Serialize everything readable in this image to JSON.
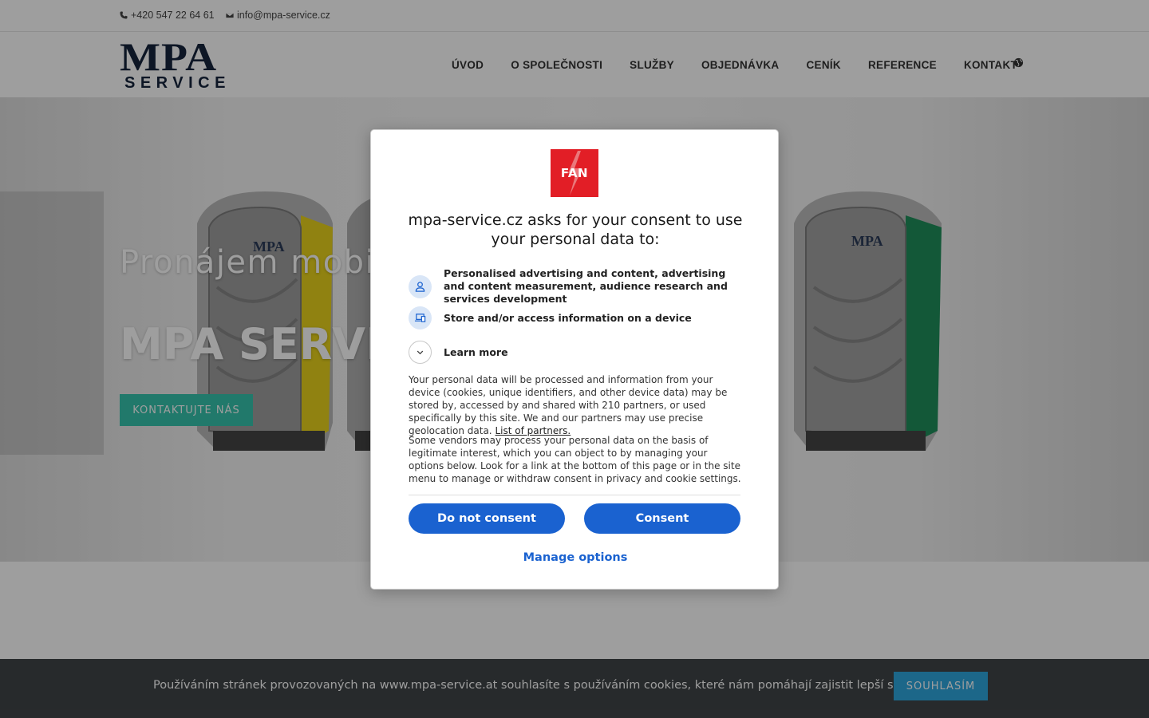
{
  "topbar": {
    "phone": "+420 547 22 64 61",
    "email": "info@mpa-service.cz"
  },
  "logo": {
    "line1": "MPA",
    "line2": "SERVICE"
  },
  "nav": {
    "items": [
      "ÚVOD",
      "O SPOLEČNOSTI",
      "SLUŽBY",
      "OBJEDNÁVKA",
      "CENÍK",
      "REFERENCE",
      "KONTAKT"
    ],
    "globe_icon": "globe-icon"
  },
  "hero": {
    "subtitle": "Pronájem mobilních",
    "title": "MPA SERVICE",
    "button": "KONTAKTUJTE NÁS",
    "toilet_colors": [
      "#e8d21c",
      "#1f8f5b"
    ]
  },
  "cookie_bar": {
    "text": "Používáním stránek provozovaných na www.mpa-service.at souhlasíte s používáním cookies, které nám pomáhají zajistit lepší služby.",
    "button": "SOUHLASÍM"
  },
  "consent": {
    "logo_text": "FAN",
    "title": "mpa-service.cz asks for your consent to use your personal data to:",
    "purposes": [
      {
        "icon": "person-icon",
        "text": "Personalised advertising and content, advertising and content measurement, audience research and services development"
      },
      {
        "icon": "devices-icon",
        "text": "Store and/or access information on a device"
      }
    ],
    "learn_more": "Learn more",
    "paragraph1": "Your personal data will be processed and information from your device (cookies, unique identifiers, and other device data) may be stored by, accessed by and shared with 210 partners, or used specifically by this site. We and our partners may use precise geolocation data.",
    "partners_link": "List of partners.",
    "paragraph2": "Some vendors may process your personal data on the basis of legitimate interest, which you can object to by managing your options below. Look for a link at the bottom of this page or in the site menu to manage or withdraw consent in privacy and cookie settings.",
    "do_not_consent": "Do not consent",
    "consent": "Consent",
    "manage_options": "Manage options"
  }
}
